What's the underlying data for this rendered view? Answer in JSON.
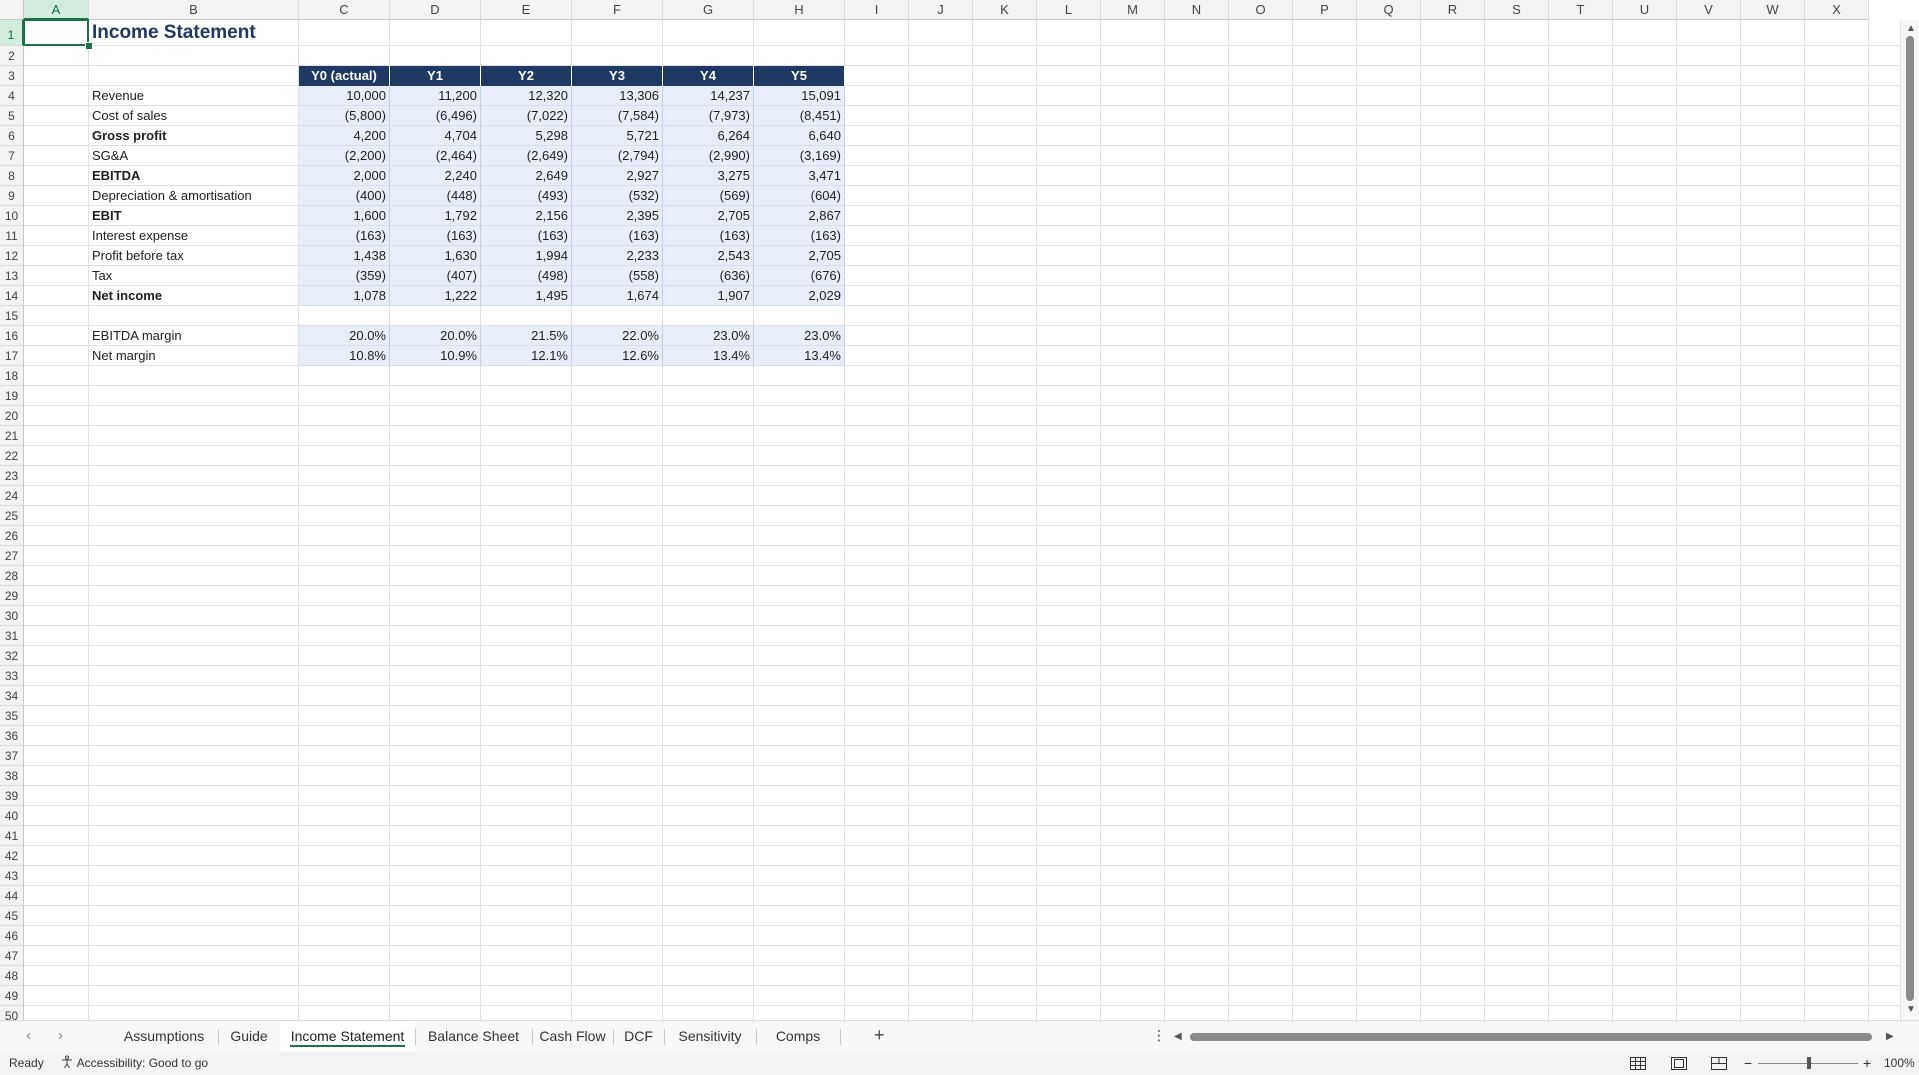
{
  "columns": [
    "A",
    "B",
    "C",
    "D",
    "E",
    "F",
    "G",
    "H",
    "I",
    "J",
    "K",
    "L",
    "M",
    "N",
    "O",
    "P",
    "Q",
    "R",
    "S",
    "T",
    "U",
    "V",
    "W",
    "X"
  ],
  "rows_visible": 50,
  "selected_cell": "A1",
  "sheet": {
    "title": "Income Statement",
    "headers": [
      "Y0 (actual)",
      "Y1",
      "Y2",
      "Y3",
      "Y4",
      "Y5"
    ],
    "lines": [
      {
        "label": "Revenue",
        "bold": false,
        "values": [
          "10,000",
          "11,200",
          "12,320",
          "13,306",
          "14,237",
          "15,091"
        ]
      },
      {
        "label": "Cost of sales",
        "bold": false,
        "values": [
          "(5,800)",
          "(6,496)",
          "(7,022)",
          "(7,584)",
          "(7,973)",
          "(8,451)"
        ]
      },
      {
        "label": "Gross profit",
        "bold": true,
        "values": [
          "4,200",
          "4,704",
          "5,298",
          "5,721",
          "6,264",
          "6,640"
        ]
      },
      {
        "label": "SG&A",
        "bold": false,
        "values": [
          "(2,200)",
          "(2,464)",
          "(2,649)",
          "(2,794)",
          "(2,990)",
          "(3,169)"
        ]
      },
      {
        "label": "EBITDA",
        "bold": true,
        "values": [
          "2,000",
          "2,240",
          "2,649",
          "2,927",
          "3,275",
          "3,471"
        ]
      },
      {
        "label": "Depreciation & amortisation",
        "bold": false,
        "values": [
          "(400)",
          "(448)",
          "(493)",
          "(532)",
          "(569)",
          "(604)"
        ]
      },
      {
        "label": "EBIT",
        "bold": true,
        "values": [
          "1,600",
          "1,792",
          "2,156",
          "2,395",
          "2,705",
          "2,867"
        ]
      },
      {
        "label": "Interest expense",
        "bold": false,
        "values": [
          "(163)",
          "(163)",
          "(163)",
          "(163)",
          "(163)",
          "(163)"
        ]
      },
      {
        "label": "Profit before tax",
        "bold": false,
        "values": [
          "1,438",
          "1,630",
          "1,994",
          "2,233",
          "2,543",
          "2,705"
        ]
      },
      {
        "label": "Tax",
        "bold": false,
        "values": [
          "(359)",
          "(407)",
          "(498)",
          "(558)",
          "(636)",
          "(676)"
        ]
      },
      {
        "label": "Net income",
        "bold": true,
        "values": [
          "1,078",
          "1,222",
          "1,495",
          "1,674",
          "1,907",
          "2,029"
        ]
      }
    ],
    "margins": [
      {
        "label": "EBITDA margin",
        "values": [
          "20.0%",
          "20.0%",
          "21.5%",
          "22.0%",
          "23.0%",
          "23.0%"
        ]
      },
      {
        "label": "Net margin",
        "values": [
          "10.8%",
          "10.9%",
          "12.1%",
          "12.6%",
          "13.4%",
          "13.4%"
        ]
      }
    ]
  },
  "tabs": [
    {
      "label": "Assumptions",
      "active": false
    },
    {
      "label": "Guide",
      "active": false
    },
    {
      "label": "Income Statement",
      "active": true
    },
    {
      "label": "Balance Sheet",
      "active": false
    },
    {
      "label": "Cash Flow",
      "active": false
    },
    {
      "label": "DCF",
      "active": false
    },
    {
      "label": "Sensitivity",
      "active": false
    },
    {
      "label": "Comps",
      "active": false
    }
  ],
  "add_sheet_label": "+",
  "status": {
    "ready": "Ready",
    "accessibility": "Accessibility: Good to go",
    "zoom": "100%",
    "zoom_minus": "−",
    "zoom_plus": "+"
  },
  "icons": {
    "prev_sheet": "chevron-left-icon",
    "next_sheet": "chevron-right-icon",
    "more": "more-vertical-icon",
    "accessibility": "accessibility-icon",
    "normal_view": "grid-view-icon",
    "page_layout": "page-layout-icon",
    "page_break": "page-break-icon"
  },
  "colors": {
    "header_bg": "#1f3864",
    "value_bg": "#e8eef9",
    "accent": "#1e7145",
    "comment_marker": "#1e8a3c"
  }
}
